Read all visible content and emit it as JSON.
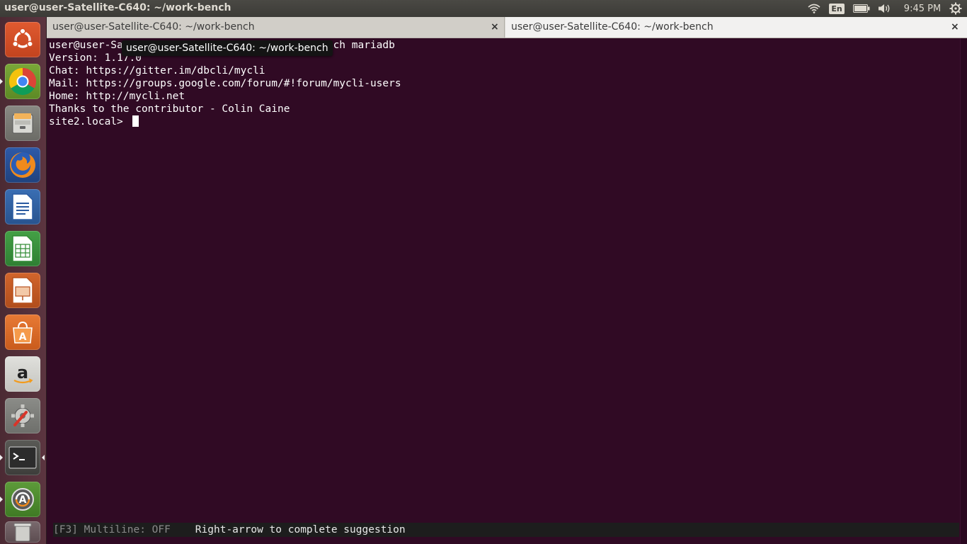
{
  "top_panel": {
    "title": "user@user-Satellite-C640: ~/work-bench",
    "keyboard_layout": "En",
    "clock": "9:45 PM",
    "icons": [
      "wifi-icon",
      "battery-icon",
      "volume-icon",
      "system-gear-icon"
    ]
  },
  "launcher": {
    "items": [
      {
        "name": "ubuntu-dash",
        "icon": "ubuntu-logo-icon"
      },
      {
        "name": "chromium",
        "icon": "chrome-icon"
      },
      {
        "name": "files",
        "icon": "files-icon"
      },
      {
        "name": "firefox",
        "icon": "firefox-icon"
      },
      {
        "name": "libreoffice-writer",
        "icon": "writer-icon"
      },
      {
        "name": "libreoffice-calc",
        "icon": "calc-icon"
      },
      {
        "name": "libreoffice-impress",
        "icon": "impress-icon"
      },
      {
        "name": "software-center",
        "icon": "software-center-icon"
      },
      {
        "name": "amazon",
        "icon": "amazon-icon"
      },
      {
        "name": "system-settings",
        "icon": "settings-icon"
      },
      {
        "name": "terminal",
        "icon": "terminal-icon"
      },
      {
        "name": "software-updater",
        "icon": "updater-icon"
      },
      {
        "name": "trash",
        "icon": "trash-icon"
      }
    ]
  },
  "terminal": {
    "tabs": [
      {
        "label": "user@user-Satellite-C640: ~/work-bench",
        "close": "×"
      },
      {
        "label": "user@user-Satellite-C640: ~/work-bench",
        "close": "×"
      }
    ],
    "tooltip": "user@user-Satellite-C640: ~/work-bench",
    "lines": [
      "user@user-Sa                                  ch mariadb",
      "Version: 1.17.0",
      "Chat: https://gitter.im/dbcli/mycli",
      "Mail: https://groups.google.com/forum/#!forum/mycli-users",
      "Home: http://mycli.net",
      "Thanks to the contributor - Colin Caine"
    ],
    "prompt": "site2.local> ",
    "status_bar": {
      "multiline": "[F3] Multiline: OFF",
      "hint": "Right-arrow to complete suggestion"
    }
  },
  "colors": {
    "terminal_bg": "#300a24",
    "terminal_fg": "#ffffff",
    "panel_bg": "#3c3b37",
    "launcher_bg": "#4b2a33"
  }
}
